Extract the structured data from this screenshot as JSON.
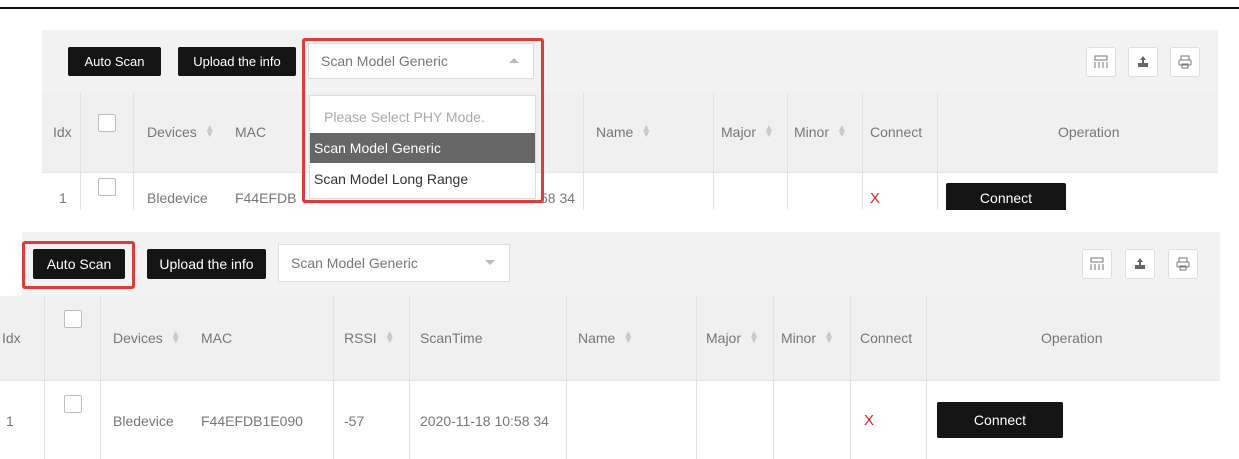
{
  "toolbar": {
    "auto_scan_label": "Auto Scan",
    "upload_label": "Upload the info",
    "scan_model_selected": "Scan Model Generic"
  },
  "dropdown": {
    "placeholder": "Please Select PHY Mode.",
    "options": [
      "Scan Model Generic",
      "Scan Model Long Range"
    ],
    "highlighted_option": "Scan Model Generic"
  },
  "table": {
    "columns": {
      "idx": "Idx",
      "devices": "Devices",
      "mac": "MAC",
      "rssi": "RSSI",
      "scantime": "ScanTime",
      "name": "Name",
      "major": "Major",
      "minor": "Minor",
      "connect": "Connect",
      "operation": "Operation"
    },
    "rows": [
      {
        "idx": "1",
        "device": "Bledevice",
        "mac": "F44EFDB1E090",
        "rssi": "-57",
        "scantime": "2020-11-18 10:58 34",
        "name": "",
        "major": "",
        "minor": "",
        "connect_status": "X",
        "operation_label": "Connect"
      }
    ]
  },
  "top_partial": {
    "mac_clipped": "F44EFDB",
    "scantime_clipped": "58 34"
  },
  "colors": {
    "highlight_outline": "#e03a3a",
    "button_dark": "#141414",
    "status_x": "#dd2222",
    "dropdown_highlight": "#666666"
  },
  "icons": [
    "columns-icon",
    "export-icon",
    "print-icon"
  ]
}
